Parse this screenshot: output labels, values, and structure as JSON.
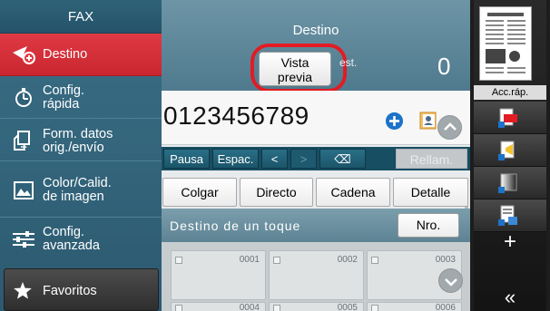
{
  "sidebar": {
    "title": "FAX",
    "items": [
      {
        "label": "Destino",
        "icon": "destination-icon",
        "active": true
      },
      {
        "label": "Config.\nrápida",
        "icon": "stopwatch-icon"
      },
      {
        "label": "Form. datos\norig./envío",
        "icon": "original-format-icon"
      },
      {
        "label": "Color/Calid.\nde imagen",
        "icon": "image-color-icon"
      },
      {
        "label": "Config.\navanzada",
        "icon": "advanced-settings-icon"
      }
    ],
    "favorites_label": "Favoritos"
  },
  "main": {
    "title": "Destino",
    "preview_line1": "Vista",
    "preview_line2": "previa",
    "dest_label": "est.",
    "dest_count": "0",
    "number": "0123456789",
    "keys": [
      "Pausa",
      "Espac.",
      "<",
      ">",
      "⌫",
      "Rellam."
    ],
    "actions": [
      "Colgar",
      "Directo",
      "Cadena",
      "Detalle"
    ],
    "one_touch_label": "Destino de un toque",
    "nro_label": "Nro.",
    "one_touch_keys": [
      "0001",
      "0002",
      "0003",
      "0004",
      "0005",
      "0006"
    ]
  },
  "right_panel": {
    "quick_access_label": "Acc.ráp.",
    "shortcuts": [
      "pdf-shortcut-icon",
      "fax-send-shortcut-icon",
      "color-shortcut-icon",
      "document-shortcut-icon"
    ],
    "add_label": "+",
    "collapse_label": "«"
  },
  "colors": {
    "active_red": "#d32f38",
    "sidebar_teal": "#2f6278",
    "highlight_ring": "#e31b23",
    "key_row": "#174e62"
  }
}
